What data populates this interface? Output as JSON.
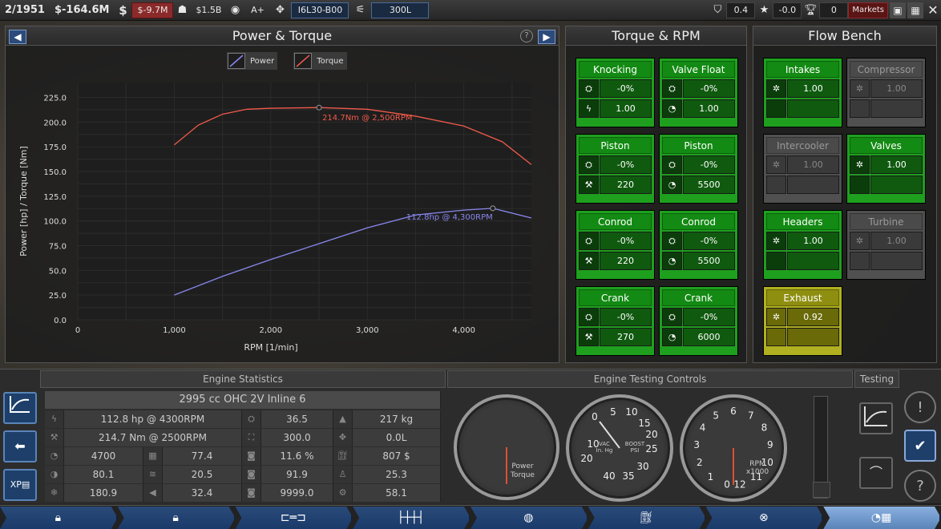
{
  "topbar": {
    "date": "2/1951",
    "money": "$-164.6M",
    "money_icon": "dollar-icon",
    "loan": "$-9.7M",
    "loan_icon": "people-icon",
    "value": "$1.5B",
    "engine_icon": "engine-icon",
    "rating": "A+",
    "family_icon": "cylinders-icon",
    "family_name": "I6L30-B00",
    "variant_icon": "variant-icon",
    "variant_name": "300L",
    "reputation": "0.4",
    "star_value": "-0.0",
    "trophy_value": "0",
    "markets": "Markets"
  },
  "power_torque": {
    "title": "Power & Torque",
    "help": "?",
    "legend_power": "Power",
    "legend_torque": "Torque",
    "colors": {
      "power": "#8a88f0",
      "torque": "#f05a4a"
    }
  },
  "chart_data": {
    "type": "line",
    "xlabel": "RPM [1/min]",
    "ylabel": "Power [hp] / Torque [Nm]",
    "xlim": [
      0,
      4700
    ],
    "ylim": [
      0,
      240
    ],
    "x_ticks": [
      "0",
      "1,000",
      "2,000",
      "3,000",
      "4,000"
    ],
    "y_ticks": [
      "0.0",
      "25.0",
      "50.0",
      "75.0",
      "100.0",
      "125.0",
      "150.0",
      "175.0",
      "200.0",
      "225.0"
    ],
    "series": [
      {
        "name": "Power",
        "x": [
          1000,
          1500,
          2000,
          2500,
          3000,
          3500,
          4000,
          4300,
          4700
        ],
        "values": [
          25,
          44,
          61,
          77,
          93,
          106,
          111,
          112.8,
          103
        ]
      },
      {
        "name": "Torque",
        "x": [
          1000,
          1250,
          1500,
          1750,
          2000,
          2500,
          3000,
          3500,
          4000,
          4400,
          4700
        ],
        "values": [
          177,
          197,
          208,
          213,
          214,
          214.7,
          213,
          206,
          196,
          180,
          157
        ]
      }
    ],
    "annotations": [
      {
        "text": "214.7Nm @ 2,500RPM",
        "x": 2500,
        "y": 214.7,
        "series": "Torque"
      },
      {
        "text": "112.8hp @ 4,300RPM",
        "x": 4300,
        "y": 112.8,
        "series": "Power"
      }
    ]
  },
  "torque_rpm": {
    "title": "Torque & RPM",
    "cards": [
      {
        "title": "Knocking",
        "r1_icon": "piston-icon",
        "r1": "-0%",
        "r2_icon": "lightning-icon",
        "r2": "1.00",
        "state": "on"
      },
      {
        "title": "Valve Float",
        "r1_icon": "piston-icon",
        "r1": "-0%",
        "r2_icon": "gauge-icon",
        "r2": "1.00",
        "state": "on"
      },
      {
        "title": "Piston",
        "r1_icon": "piston-icon",
        "r1": "-0%",
        "r2_icon": "wrench-icon",
        "r2": "220",
        "state": "on"
      },
      {
        "title": "Piston",
        "r1_icon": "piston-icon",
        "r1": "-0%",
        "r2_icon": "gauge-icon",
        "r2": "5500",
        "state": "on"
      },
      {
        "title": "Conrod",
        "r1_icon": "piston-icon",
        "r1": "-0%",
        "r2_icon": "wrench-icon",
        "r2": "220",
        "state": "on"
      },
      {
        "title": "Conrod",
        "r1_icon": "piston-icon",
        "r1": "-0%",
        "r2_icon": "gauge-icon",
        "r2": "5500",
        "state": "on"
      },
      {
        "title": "Crank",
        "r1_icon": "piston-icon",
        "r1": "-0%",
        "r2_icon": "wrench-icon",
        "r2": "270",
        "state": "on"
      },
      {
        "title": "Crank",
        "r1_icon": "piston-icon",
        "r1": "-0%",
        "r2_icon": "gauge-icon",
        "r2": "6000",
        "state": "on"
      }
    ]
  },
  "flow_bench": {
    "title": "Flow Bench",
    "cards": [
      {
        "title": "Intakes",
        "value": "1.00",
        "state": "on"
      },
      {
        "title": "Compressor",
        "value": "1.00",
        "state": "off"
      },
      {
        "title": "Intercooler",
        "value": "1.00",
        "state": "off"
      },
      {
        "title": "Valves",
        "value": "1.00",
        "state": "on"
      },
      {
        "title": "Headers",
        "value": "1.00",
        "state": "on"
      },
      {
        "title": "Turbine",
        "value": "1.00",
        "state": "off"
      },
      {
        "title": "Exhaust",
        "value": "0.92",
        "state": "warn"
      }
    ]
  },
  "engine_stats": {
    "header": "Engine Statistics",
    "summary": "2995 cc OHC 2V  Inline 6",
    "rows": [
      {
        "c1": "112.8 hp @ 4300RPM",
        "c2": "",
        "c3": "36.5",
        "c4": "217 kg"
      },
      {
        "c1": "214.7 Nm @ 2500RPM",
        "c2": "",
        "c3": "300.0",
        "c4": "0.0L"
      },
      {
        "c1": "4700",
        "c2": "77.4",
        "c3": "11.6 %",
        "c4": "807 $"
      },
      {
        "c1": "80.1",
        "c2": "20.5",
        "c3": "91.9",
        "c4": "25.3"
      },
      {
        "c1": "180.9",
        "c2": "32.4",
        "c3": "9999.0",
        "c4": "58.1"
      }
    ]
  },
  "testing": {
    "header": "Engine Testing Controls",
    "testing_label": "Testing",
    "gauge1_label": "Power\nTorque",
    "gauge2_label": "VAC\nIn. Hg",
    "gauge2_boost": "BOOST\nPSI",
    "gauge2_ticks": [
      "0",
      "5",
      "10",
      "15",
      "20",
      "25",
      "30",
      "35",
      "40",
      "10",
      "20"
    ],
    "gauge3_ticks": [
      "0",
      "1",
      "2",
      "3",
      "4",
      "5",
      "6",
      "7",
      "8",
      "9",
      "10",
      "11",
      "12"
    ],
    "gauge3_label": "RPM\nx1000"
  }
}
